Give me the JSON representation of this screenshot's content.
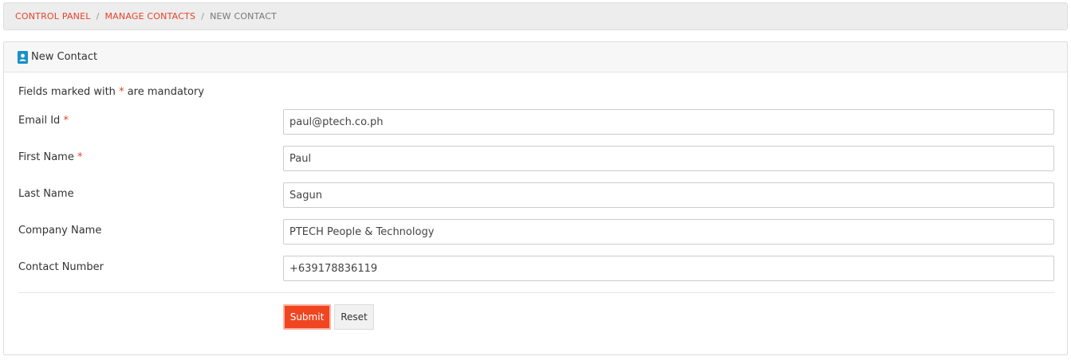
{
  "breadcrumb": {
    "items": [
      {
        "label": "CONTROL PANEL"
      },
      {
        "label": "MANAGE CONTACTS"
      },
      {
        "label": "NEW CONTACT"
      }
    ],
    "separator": "/"
  },
  "panel": {
    "title": "New Contact",
    "icon": "contact-card-icon",
    "icon_color": "#1a8fc9"
  },
  "form": {
    "note_prefix": "Fields marked with",
    "note_asterisk": "*",
    "note_suffix": "are mandatory",
    "required_marker": "*",
    "fields": {
      "email": {
        "label": "Email Id",
        "value": "paul@ptech.co.ph"
      },
      "first_name": {
        "label": "First Name",
        "value": "Paul"
      },
      "last_name": {
        "label": "Last Name",
        "value": "Sagun"
      },
      "company_name": {
        "label": "Company Name",
        "value": "PTECH People & Technology"
      },
      "contact_number": {
        "label": "Contact Number",
        "value": "+639178836119"
      }
    },
    "submit_label": "Submit",
    "reset_label": "Reset"
  },
  "colors": {
    "accent": "#e8412a",
    "submit_bg": "#f04521"
  }
}
